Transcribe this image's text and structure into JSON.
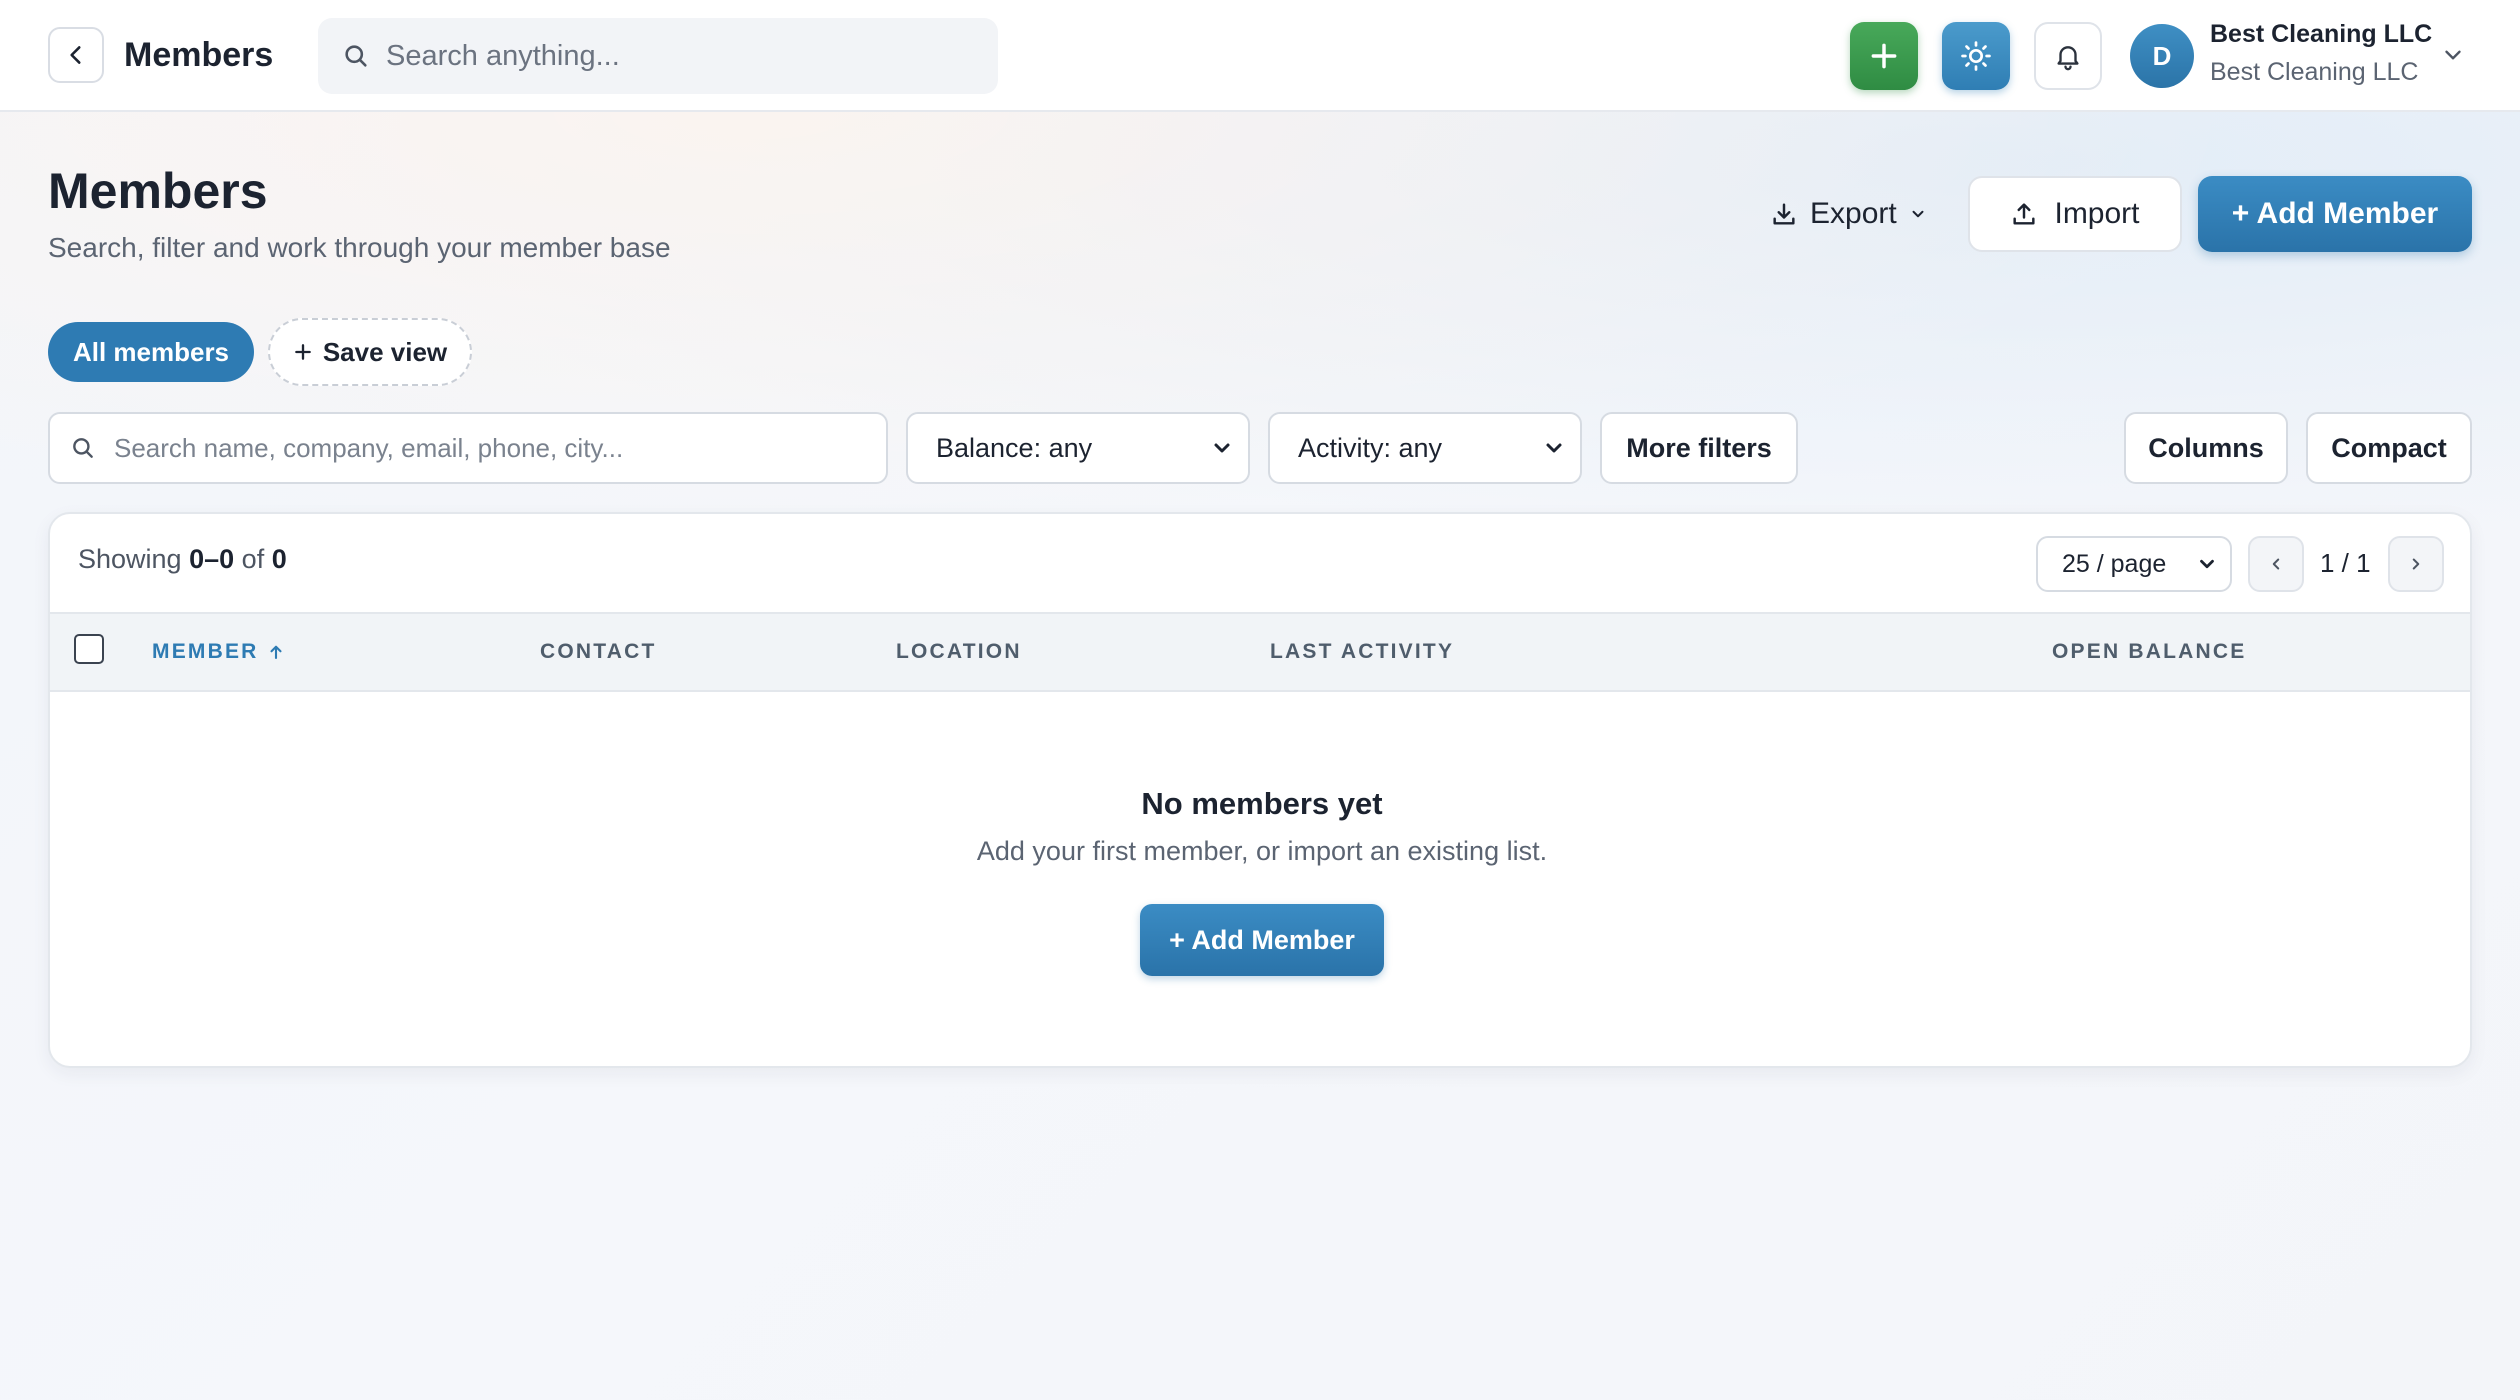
{
  "topbar": {
    "title": "Members",
    "search_placeholder": "Search anything...",
    "org_name": "Best Cleaning LLC",
    "org_sub": "Best Cleaning LLC",
    "avatar_initial": "D"
  },
  "header": {
    "title": "Members",
    "subtitle": "Search, filter and work through your member base",
    "export_label": "Export",
    "import_label": "Import",
    "add_member_label": "+ Add Member"
  },
  "views": {
    "all_label": "All members",
    "save_label": "Save view"
  },
  "filters": {
    "search_placeholder": "Search name, company, email, phone, city...",
    "balance": "Balance: any",
    "activity": "Activity: any",
    "more_label": "More filters",
    "columns_label": "Columns",
    "compact_label": "Compact"
  },
  "table": {
    "showing_prefix": "Showing",
    "showing_range": "0–0",
    "showing_of": "of",
    "showing_total": "0",
    "per_page": "25 / page",
    "page_indicator": "1 / 1",
    "columns": {
      "member": "MEMBER",
      "contact": "CONTACT",
      "location": "LOCATION",
      "last_activity": "LAST ACTIVITY",
      "open_balance": "OPEN BALANCE"
    },
    "empty_title": "No members yet",
    "empty_subtitle": "Add your first member, or import an existing list.",
    "empty_add_label": "+ Add Member"
  },
  "colors": {
    "primary": "#2e7bb3",
    "success": "#3a9a4f"
  }
}
